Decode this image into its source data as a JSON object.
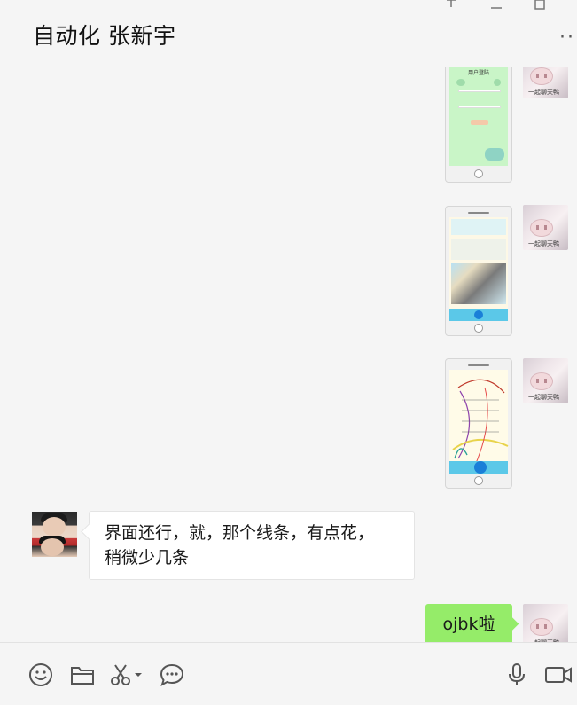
{
  "header": {
    "title": "自动化  张新宇",
    "window_controls": [
      "pin-icon",
      "minimize-icon",
      "maximize-icon"
    ],
    "more_label": "··"
  },
  "messages": [
    {
      "side": "right",
      "type": "image",
      "description_icon": "phone-screenshot-login",
      "login_title": "用户登陆"
    },
    {
      "side": "right",
      "type": "image",
      "description_icon": "phone-screenshot-feed"
    },
    {
      "side": "right",
      "type": "image",
      "description_icon": "phone-screenshot-list"
    },
    {
      "side": "left",
      "type": "text",
      "text_line1": "界面还行，就，那个线条，有点花，",
      "text_line2": "稍微少几条"
    },
    {
      "side": "right",
      "type": "text",
      "text": "ojbk啦"
    }
  ],
  "avatars": {
    "self_caption": "一起聊天鸭"
  },
  "toolbar": {
    "icons": [
      "emoji-icon",
      "folder-icon",
      "scissors-icon",
      "chat-bubble-icon",
      "microphone-icon",
      "video-call-icon"
    ]
  },
  "colors": {
    "background": "#f5f5f5",
    "self_bubble": "#95ec69",
    "other_bubble": "#ffffff"
  }
}
